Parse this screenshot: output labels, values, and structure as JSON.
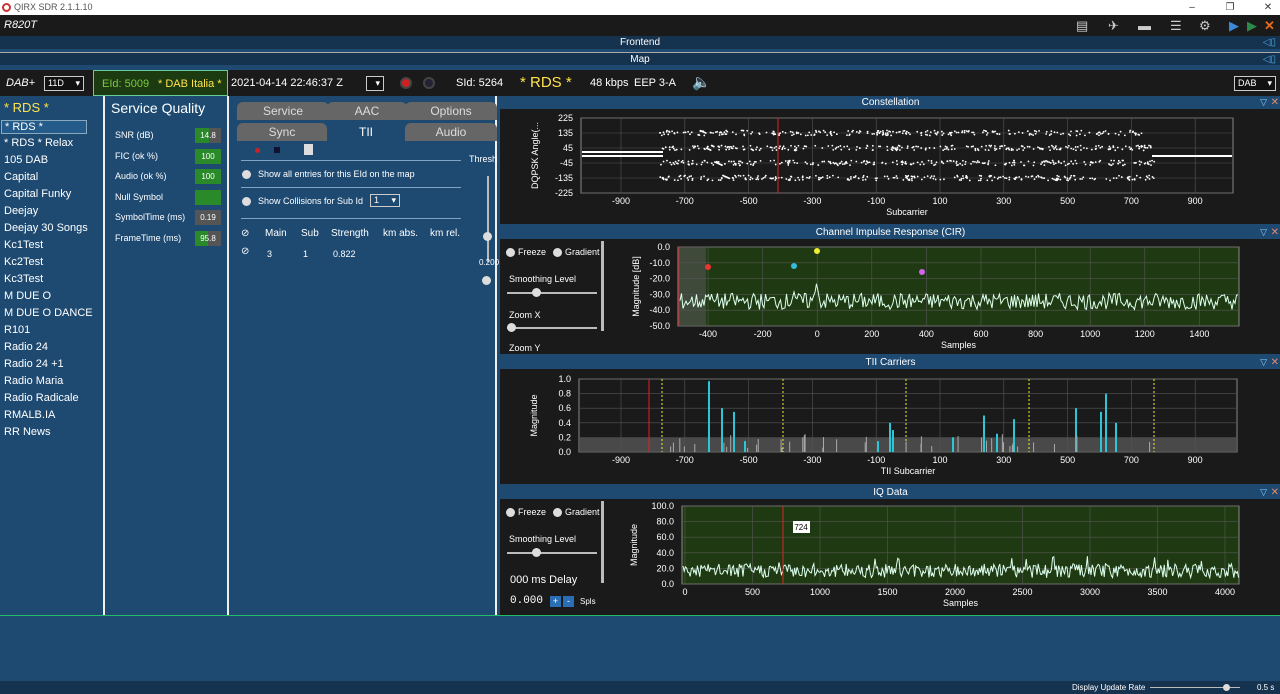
{
  "window": {
    "title": "QIRX SDR 2.1.1.10",
    "min": "–",
    "restore": "❐",
    "close": "✕"
  },
  "toolbar": {
    "device": "R820T"
  },
  "sections": {
    "frontend": "Frontend",
    "map": "Map"
  },
  "infobar": {
    "dab_plus": "DAB+",
    "channel": "11D",
    "eid": "EId: 5009",
    "ensemble": "* DAB Italia *",
    "datetime": "2021-04-14  22:46:37 Z",
    "sid": "SId: 5264",
    "service": "* RDS *",
    "bitrate": "48 kbps",
    "eep": "EEP 3-A",
    "mode": "DAB"
  },
  "services": {
    "header": "* RDS *",
    "items": [
      "* RDS *",
      "* RDS * Relax",
      "105 DAB",
      "Capital",
      "Capital Funky",
      "Deejay",
      "Deejay 30 Songs",
      "Kc1Test",
      "Kc2Test",
      "Kc3Test",
      "M DUE O",
      "M DUE O DANCE",
      "R101",
      "Radio 24",
      "Radio 24 +1",
      "Radio Maria",
      "Radio Radicale",
      "RMALB.IA",
      "RR News"
    ]
  },
  "quality": {
    "header": "Service Quality",
    "rows": [
      {
        "label": "SNR (dB)",
        "value": "14.8",
        "fill": 0.55
      },
      {
        "label": "FIC (ok %)",
        "value": "100",
        "fill": 1
      },
      {
        "label": "Audio (ok %)",
        "value": "100",
        "fill": 1
      },
      {
        "label": "Null Symbol",
        "value": "",
        "fill": 1
      },
      {
        "label": "SymbolTime (ms)",
        "value": "0.19",
        "fill": 0
      },
      {
        "label": "FrameTime (ms)",
        "value": "95.8",
        "fill": 0.5
      }
    ]
  },
  "tabs": {
    "service": "Service",
    "aac": "AAC",
    "options": "Options",
    "sync": "Sync",
    "tii": "TII",
    "audio": "Audio"
  },
  "tii": {
    "show_all": "Show all entries for this EId on the map",
    "show_collisions": "Show Collisions for Sub Id",
    "sub_id": "1",
    "thresh": "Thresh",
    "thresh_val": "0.200",
    "cols": [
      "Main",
      "Sub",
      "Strength",
      "km abs.",
      "km rel."
    ],
    "row": [
      "3",
      "1",
      "0.822",
      "",
      ""
    ]
  },
  "panels": {
    "constellation": {
      "title": "Constellation",
      "ylabel": "DQPSK Angle(...",
      "xlabel": "Subcarrier",
      "yticks": [
        "225",
        "135",
        "45",
        "-45",
        "-135",
        "-225"
      ],
      "xticks": [
        "-900",
        "-700",
        "-500",
        "-300",
        "-100",
        "100",
        "300",
        "500",
        "700",
        "900"
      ]
    },
    "cir": {
      "title": "Channel Impulse Response (CIR)",
      "freeze": "Freeze",
      "gradient": "Gradient",
      "smoothing": "Smoothing Level",
      "zoomx": "Zoom X",
      "zoomy": "Zoom Y",
      "ylabel": "Magnitude [dB]",
      "xlabel": "Samples",
      "yticks": [
        "0.0",
        "-10.0",
        "-20.0",
        "-30.0",
        "-40.0",
        "-50.0"
      ],
      "xticks": [
        "-400",
        "-200",
        "0",
        "200",
        "400",
        "600",
        "800",
        "1000",
        "1200",
        "1400"
      ]
    },
    "tiic": {
      "title": "TII Carriers",
      "ylabel": "Magnitude",
      "xlabel": "TII Subcarrier",
      "yticks": [
        "1.0",
        "0.8",
        "0.6",
        "0.4",
        "0.2",
        "0.0"
      ],
      "xticks": [
        "-900",
        "-700",
        "-500",
        "-300",
        "-100",
        "100",
        "300",
        "500",
        "700",
        "900"
      ]
    },
    "iq": {
      "title": "IQ Data",
      "freeze": "Freeze",
      "gradient": "Gradient",
      "smoothing": "Smoothing Level",
      "delay": "000 ms Delay",
      "delay_val": "0.000",
      "spls": "Spls",
      "marker": "724",
      "ylabel": "Magnitude",
      "xlabel": "Samples",
      "yticks": [
        "100.0",
        "80.0",
        "60.0",
        "40.0",
        "20.0",
        "0.0"
      ],
      "xticks": [
        "0",
        "500",
        "1000",
        "1500",
        "2000",
        "2500",
        "3000",
        "3500",
        "4000"
      ]
    }
  },
  "status": {
    "label": "Display Update Rate",
    "value": "0.5 s"
  }
}
